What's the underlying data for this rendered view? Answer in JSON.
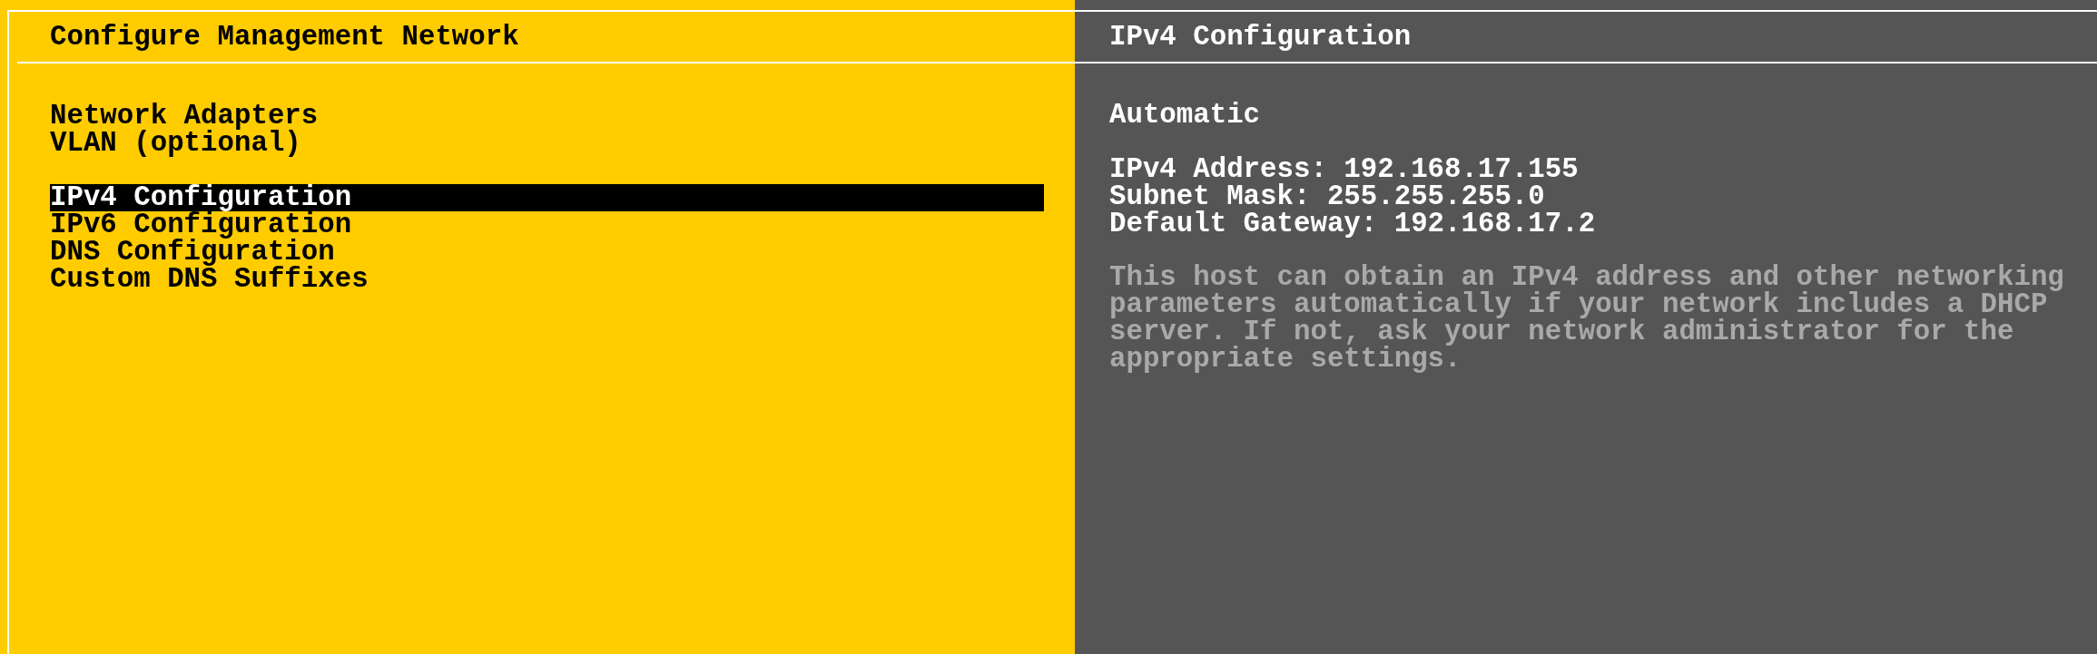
{
  "left_panel": {
    "title": "Configure Management Network",
    "menu_groups": [
      {
        "items": [
          {
            "label": "Network Adapters",
            "selected": false
          },
          {
            "label": "VLAN (optional)",
            "selected": false
          }
        ]
      },
      {
        "items": [
          {
            "label": "IPv4 Configuration",
            "selected": true
          },
          {
            "label": "IPv6 Configuration",
            "selected": false
          },
          {
            "label": "DNS Configuration",
            "selected": false
          },
          {
            "label": "Custom DNS Suffixes",
            "selected": false
          }
        ]
      }
    ]
  },
  "right_panel": {
    "title": "IPv4 Configuration",
    "mode": "Automatic",
    "fields": [
      {
        "label": "IPv4 Address:",
        "value": "192.168.17.155"
      },
      {
        "label": "Subnet Mask:",
        "value": "255.255.255.0"
      },
      {
        "label": "Default Gateway:",
        "value": "192.168.17.2"
      }
    ],
    "description": "This host can obtain an IPv4 address and other networking parameters automatically if your network includes a DHCP server. If not, ask your network administrator for the appropriate settings."
  }
}
